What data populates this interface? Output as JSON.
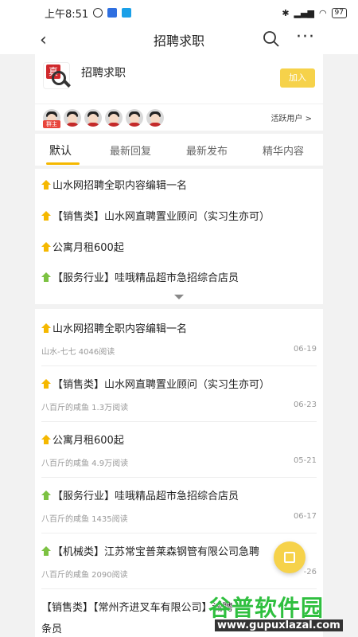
{
  "status_bar": {
    "time": "上午8:51",
    "battery": "97"
  },
  "nav": {
    "title": "招聘求职"
  },
  "group": {
    "logo_char": "真",
    "name": "招聘求职",
    "join_label": "加入",
    "owner_badge": "群主",
    "active_users_label": "活跃用户 >"
  },
  "tabs": [
    {
      "label": "默认"
    },
    {
      "label": "最新回复"
    },
    {
      "label": "最新发布"
    },
    {
      "label": "精华内容"
    }
  ],
  "pinned": [
    {
      "title": "山水网招聘全职内容编辑一名"
    },
    {
      "title": "【销售类】山水网直聘置业顾问（实习生亦可）"
    },
    {
      "title": "公寓月租600起"
    },
    {
      "title": "【服务行业】哇哦精品超市急招综合店员"
    }
  ],
  "posts": [
    {
      "title": "山水网招聘全职内容编辑一名",
      "meta": "山水-七七 4046阅读",
      "date": "06-19"
    },
    {
      "title": "【销售类】山水网直聘置业顾问（实习生亦可）",
      "meta": "八百斤的咸鱼 1.3万阅读",
      "date": "06-23"
    },
    {
      "title": "公寓月租600起",
      "meta": "八百斤的咸鱼 4.9万阅读",
      "date": "05-21"
    },
    {
      "title": "【服务行业】哇哦精品超市急招综合店员",
      "meta": "八百斤的咸鱼 1435阅读",
      "date": "06-17"
    },
    {
      "title": "【机械类】江苏常宝普莱森钢管有限公司急聘",
      "meta": "八百斤的咸鱼 2090阅读",
      "date": "-26"
    },
    {
      "title": "【销售类】【常州齐进叉车有限公司】诚聘",
      "meta": "条员",
      "date": ""
    }
  ],
  "watermark": {
    "name": "谷普软件园",
    "url": "www.gupuxlazal.com"
  },
  "colors": {
    "accent": "#f5b800",
    "join": "#f6d24a",
    "pin_green": "#7cc242",
    "badge_red": "#e8453c"
  }
}
